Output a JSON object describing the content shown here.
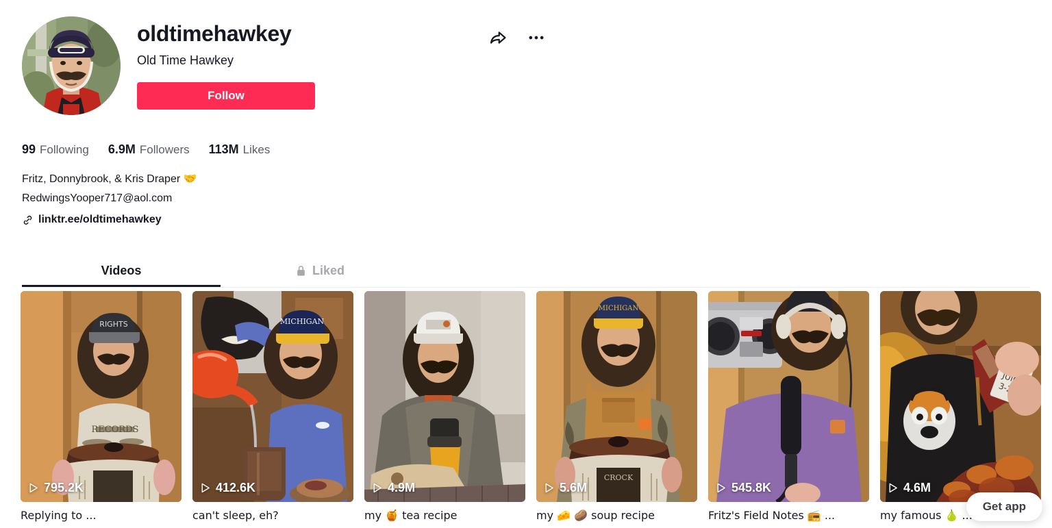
{
  "profile": {
    "username": "oldtimehawkey",
    "display_name": "Old Time Hawkey",
    "follow_label": "Follow",
    "avatar_alt": "avatar",
    "share_icon": "share-arrow-icon",
    "more_icon": "ellipsis-icon"
  },
  "stats": [
    {
      "value": "99",
      "label": "Following"
    },
    {
      "value": "6.9M",
      "label": "Followers"
    },
    {
      "value": "113M",
      "label": "Likes"
    }
  ],
  "bio": {
    "text": "Fritz, Donnybrook, & Kris Draper 🤝\nRedwingsYooper717@aol.com",
    "link_text": "linktr.ee/oldtimehawkey",
    "link_icon": "link-chain-icon"
  },
  "tabs": [
    {
      "label": "Videos",
      "active": true,
      "icon": ""
    },
    {
      "label": "Liked",
      "active": false,
      "icon": "lock-icon"
    }
  ],
  "videos": [
    {
      "views": "795.2K",
      "caption": "Replying to ...",
      "play_icon": "play-icon"
    },
    {
      "views": "412.6K",
      "caption": "can't sleep, eh?",
      "play_icon": "play-icon"
    },
    {
      "views": "4.9M",
      "caption": "my 🍯 tea recipe",
      "play_icon": "play-icon"
    },
    {
      "views": "5.6M",
      "caption": "my 🧀 🥔 soup recipe",
      "play_icon": "play-icon"
    },
    {
      "views": "545.8K",
      "caption": "Fritz's Field Notes 📻 ...",
      "play_icon": "play-icon"
    },
    {
      "views": "4.6M",
      "caption": "my famous 🍐 ...",
      "play_icon": "play-icon"
    }
  ],
  "footer": {
    "get_app_label": "Get app"
  },
  "colors": {
    "accent_pink": "#FE2C55",
    "text_primary": "#161823",
    "text_secondary": "#5b5d65",
    "tab_inactive": "#a6a8ad",
    "divider": "#ecedf0"
  }
}
